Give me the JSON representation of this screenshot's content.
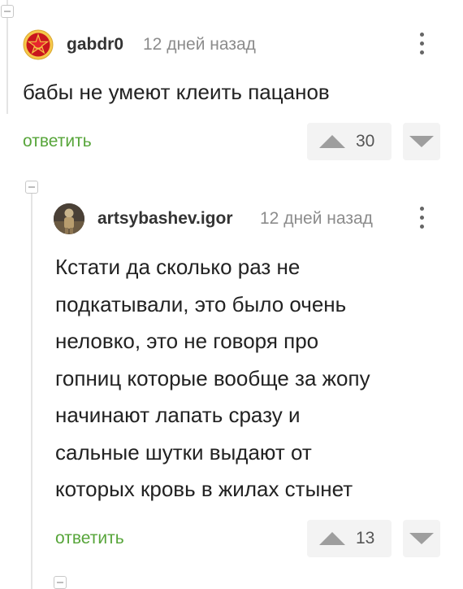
{
  "comments": [
    {
      "username": "gabdr0",
      "time": "12 дней назад",
      "text": "бабы не умеют клеить пацанов",
      "reply_label": "ответить",
      "votes": "30"
    },
    {
      "username": "artsybashev.igor",
      "time": "12 дней назад",
      "text_lines": [
        "Кстати да сколько раз не",
        "подкатывали, это было очень",
        "неловко, это не говоря про",
        "гопниц которые вообще за жопу",
        "начинают лапать сразу и",
        "сальные шутки выдают от",
        "которых кровь в жилах стынет"
      ],
      "reply_label": "ответить",
      "votes": "13"
    }
  ],
  "colors": {
    "accent_green": "#57a53a",
    "muted": "#8c8c8c",
    "vote_bg": "#f3f3f3"
  }
}
